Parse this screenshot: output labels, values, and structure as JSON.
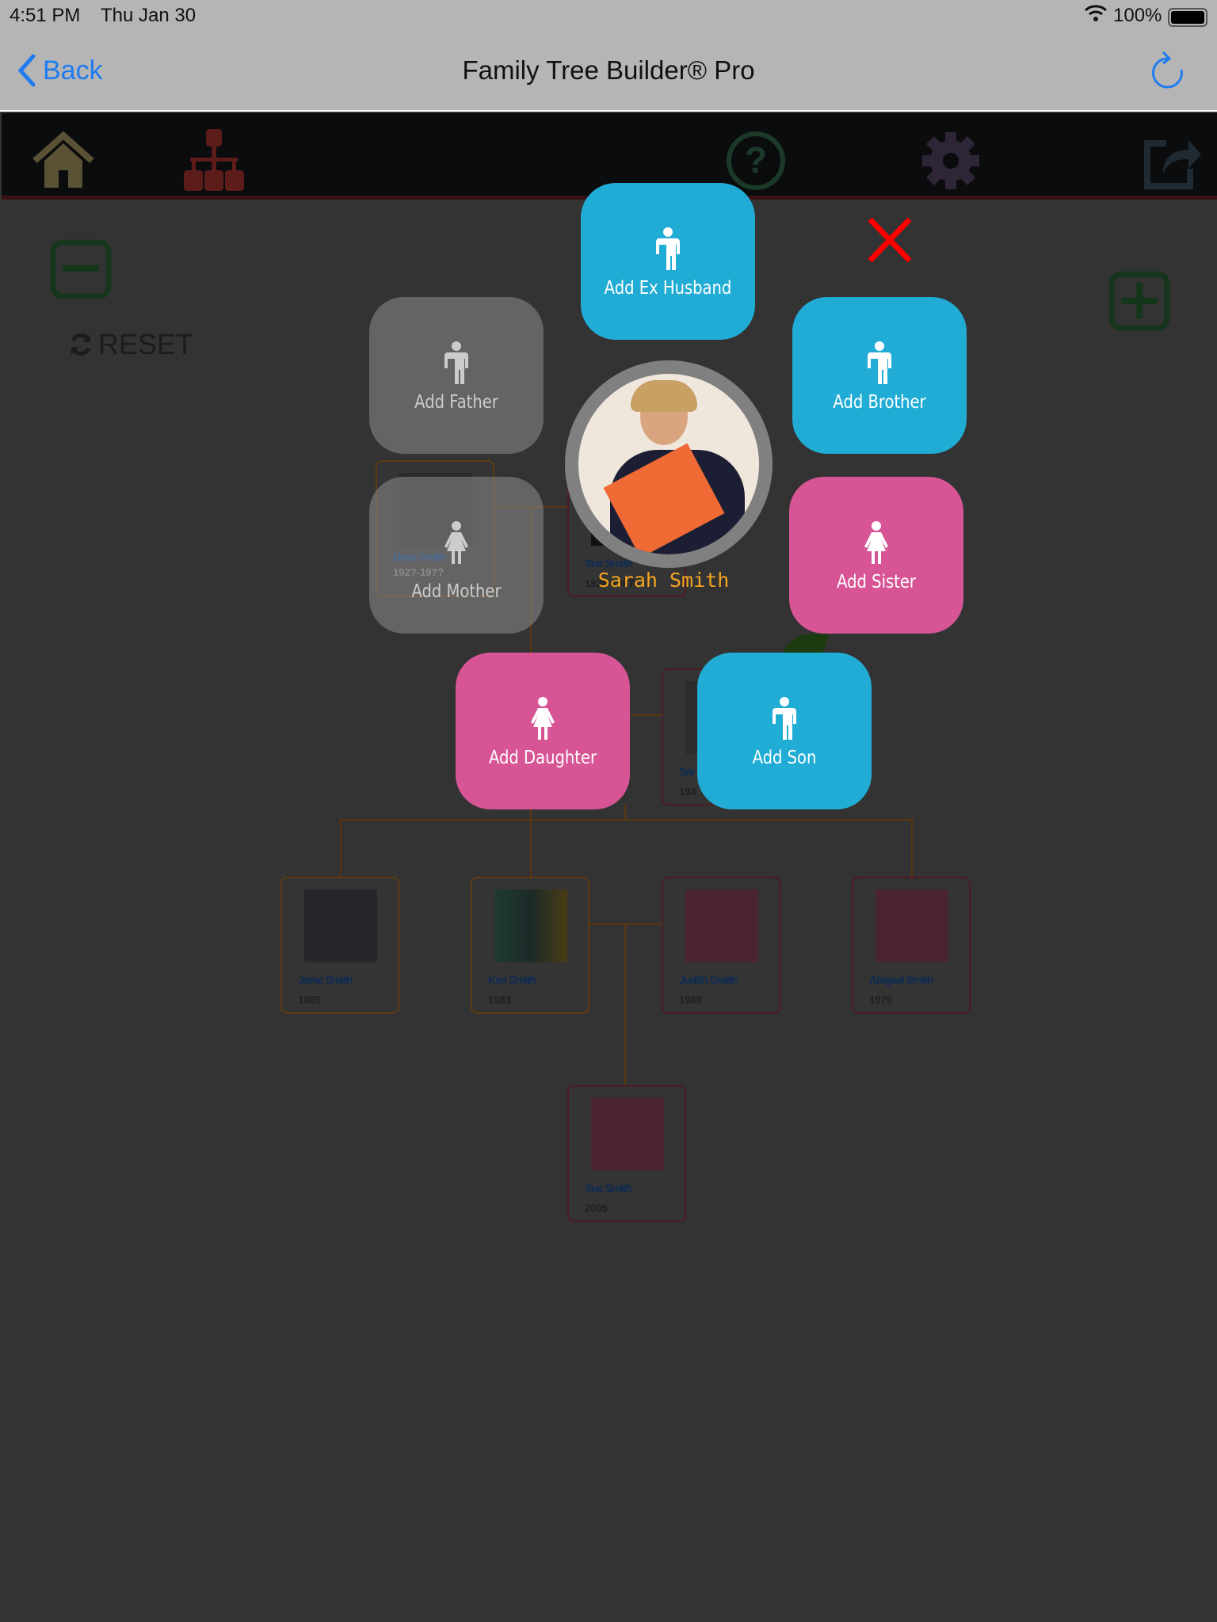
{
  "status": {
    "time": "4:51 PM",
    "date": "Thu Jan 30",
    "battery": "100%"
  },
  "nav": {
    "back": "Back",
    "title": "Family Tree Builder® Pro"
  },
  "toolbar": {
    "icons": [
      "home-icon",
      "tree-icon",
      "help-icon",
      "gear-icon",
      "share-icon"
    ]
  },
  "canvas": {
    "reset": "RESET"
  },
  "popup": {
    "person": "Sarah Smith",
    "buttons": {
      "ex_husband": "Add Ex Husband",
      "father": "Add Father",
      "brother": "Add Brother",
      "mother": "Add Mother",
      "sister": "Add Sister",
      "daughter": "Add Daughter",
      "son": "Add Son"
    },
    "colors": {
      "male": "#21acd5",
      "female": "#d75594",
      "disabled": "#8c8c8c",
      "name": "#f5a623",
      "close": "#ff0000"
    }
  },
  "tree": {
    "cards": [
      {
        "name": "Dave Smith",
        "year": "192?-19??"
      },
      {
        "name": "Sue Smith",
        "year": "1828-1867"
      },
      {
        "name": "Sar",
        "year": "194"
      },
      {
        "name": "Jame Smith",
        "year": "1985"
      },
      {
        "name": "Ken Smith",
        "year": "1983"
      },
      {
        "name": "Judith Smith",
        "year": "1989"
      },
      {
        "name": "Abigael Smith",
        "year": "1979"
      },
      {
        "name": "Sue Smith",
        "year": "2005"
      }
    ]
  }
}
